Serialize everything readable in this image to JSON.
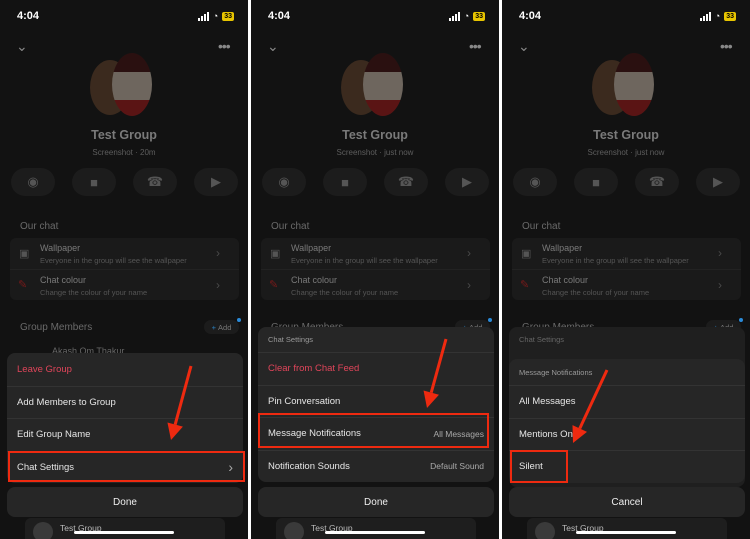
{
  "status": {
    "time": "4:04",
    "battery": "33"
  },
  "group": {
    "name": "Test Group",
    "app_label": "Screenshot"
  },
  "panels": [
    {
      "subtitle": "Screenshot · 20m"
    },
    {
      "subtitle": "Screenshot · just now"
    },
    {
      "subtitle": "Screenshot · just now"
    }
  ],
  "our_chat": {
    "heading": "Our chat",
    "wallpaper": {
      "title": "Wallpaper",
      "desc": "Everyone in the group will see the wallpaper"
    },
    "chat_colour": {
      "title": "Chat colour",
      "desc": "Change the colour of your name"
    }
  },
  "members": {
    "heading": "Group Members",
    "add_label": "Add",
    "first_member": "Akash Om Thakur"
  },
  "bottom_chat": {
    "name": "Test Group"
  },
  "menu1": {
    "items": [
      "Leave Group",
      "Add Members to Group",
      "Edit Group Name",
      "Chat Settings"
    ],
    "done": "Done"
  },
  "menu2": {
    "header": "Chat Settings",
    "items": [
      "Clear from Chat Feed",
      "Pin Conversation",
      "Message Notifications",
      "Notification Sounds"
    ],
    "values": {
      "message_notifications": "All Messages",
      "notification_sounds": "Default Sound"
    },
    "done": "Done"
  },
  "menu3": {
    "back_header": "Chat Settings",
    "header": "Message Notifications",
    "items": [
      "All Messages",
      "Mentions Only",
      "Silent"
    ],
    "cancel": "Cancel"
  },
  "colors": {
    "accent_red": "#e0455a",
    "highlight": "#ee2a10",
    "sheet": "#262626"
  }
}
